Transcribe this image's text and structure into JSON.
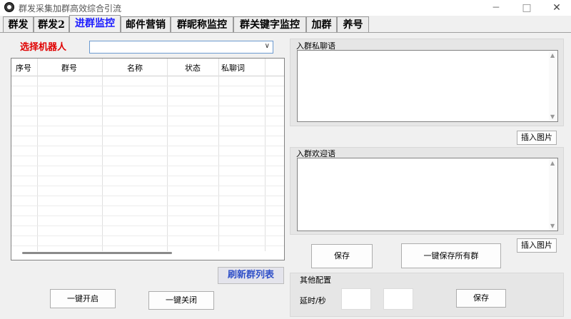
{
  "window": {
    "title": "群发采集加群高效综合引流",
    "minimize": "─",
    "maximize": "□",
    "close": "✕"
  },
  "tabs": [
    {
      "label": "群发",
      "active": false
    },
    {
      "label": "群发2",
      "active": false
    },
    {
      "label": "进群监控",
      "active": true
    },
    {
      "label": "邮件营销",
      "active": false
    },
    {
      "label": "群昵称监控",
      "active": false
    },
    {
      "label": "群关键字监控",
      "active": false
    },
    {
      "label": "加群",
      "active": false
    },
    {
      "label": "养号",
      "active": false
    }
  ],
  "left": {
    "robot_label": "选择机器人",
    "robot_select_value": "",
    "table": {
      "columns": [
        "序号",
        "群号",
        "名称",
        "状态",
        "私聊词"
      ],
      "rows": []
    },
    "refresh_label": "刷新群列表",
    "start_all_label": "一键开启",
    "close_all_label": "一键关闭"
  },
  "right": {
    "private_msg_label": "入群私聊语",
    "private_msg_value": "",
    "insert_image_label_1": "插入图片",
    "welcome_label": "入群欢迎语",
    "welcome_value": "",
    "insert_image_label_2": "插入图片",
    "save_label": "保存",
    "save_all_label": "一键保存所有群",
    "other_config_label": "其他配置",
    "delay_label": "延时/秒",
    "delay_min": "",
    "delay_max": "",
    "config_save_label": "保存"
  },
  "colors": {
    "active_tab": "#1a1aff",
    "robot_label": "#e00000",
    "refresh_text": "#3050c8"
  }
}
